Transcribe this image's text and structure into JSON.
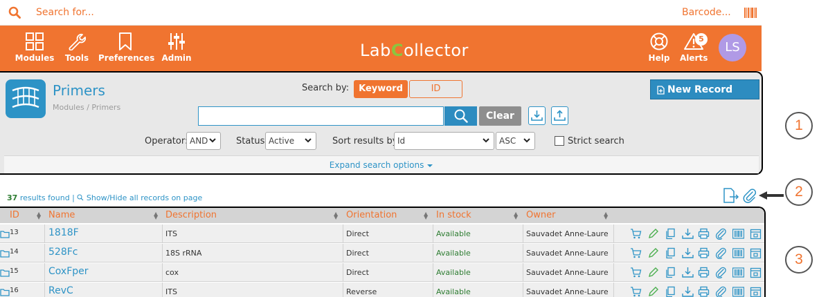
{
  "topbar": {
    "search_placeholder": "Search for...",
    "barcode_label": "Barcode..."
  },
  "nav": {
    "items": [
      {
        "label": "Modules",
        "icon": "grid-icon"
      },
      {
        "label": "Tools",
        "icon": "wrench-icon"
      },
      {
        "label": "Preferences",
        "icon": "bookmark-icon"
      },
      {
        "label": "Admin",
        "icon": "sliders-icon"
      }
    ],
    "logo_left": "Lab",
    "logo_c": "C",
    "logo_right": "ollector",
    "help_label": "Help",
    "alerts_label": "Alerts",
    "alerts_count": "5",
    "avatar_initials": "LS"
  },
  "module": {
    "title": "Primers",
    "breadcrumb": "Modules / Primers"
  },
  "search": {
    "search_by_label": "Search by:",
    "keyword_label": "Keyword",
    "id_label": "ID",
    "new_record_label": "New Record",
    "clear_label": "Clear",
    "operator_label": "Operator:",
    "operator_value": "AND",
    "status_label": "Status:",
    "status_value": "Active",
    "sort_label": "Sort results by:",
    "sort_value": "Id",
    "sort_order_value": "ASC",
    "strict_label": "Strict search",
    "expand_label": "Expand search options"
  },
  "callouts": [
    "1",
    "2",
    "3"
  ],
  "results": {
    "count": "37",
    "found_text": "results found |",
    "show_hide_text": "Show/Hide all records on page"
  },
  "table": {
    "headers": [
      "ID",
      "Name",
      "Description",
      "Orientation",
      "In stock",
      "Owner"
    ],
    "rows": [
      {
        "id": "13",
        "name": "1818F",
        "description": "ITS",
        "orientation": "Direct",
        "stock": "Available",
        "owner": "Sauvadet Anne-Laure"
      },
      {
        "id": "14",
        "name": "528Fc",
        "description": "18S rRNA",
        "orientation": "Direct",
        "stock": "Available",
        "owner": "Sauvadet Anne-Laure"
      },
      {
        "id": "15",
        "name": "CoxFper",
        "description": "cox",
        "orientation": "Direct",
        "stock": "Available",
        "owner": "Sauvadet Anne-Laure"
      },
      {
        "id": "16",
        "name": "RevC",
        "description": "ITS",
        "orientation": "Reverse",
        "stock": "Available",
        "owner": "Sauvadet Anne-Laure"
      }
    ]
  },
  "colors": {
    "accent": "#f07430",
    "primary": "#2d93c6",
    "stock": "#2e7d32"
  }
}
